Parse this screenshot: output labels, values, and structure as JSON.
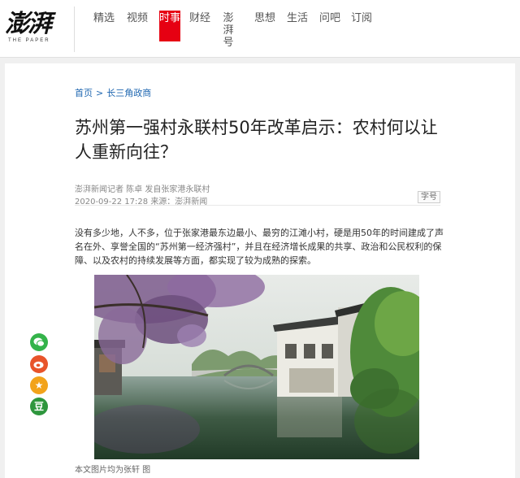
{
  "header": {
    "logo_text": "澎湃",
    "logo_sub": "THE PAPER",
    "nav": [
      {
        "label": "精选"
      },
      {
        "label": "视频"
      },
      {
        "label": "时事"
      },
      {
        "label": "财经"
      },
      {
        "label": "澎湃号"
      },
      {
        "label": "思想"
      },
      {
        "label": "生活"
      },
      {
        "label": "问吧"
      },
      {
        "label": "订阅"
      }
    ],
    "active_color": "#e60012"
  },
  "breadcrumb": {
    "home": "首页",
    "separator": ">",
    "section": "长三角政商"
  },
  "article": {
    "title": "苏州第一强村永联村50年改革启示：农村何以让人重新向往？",
    "byline": "澎湃新闻记者 陈卓 发自张家港永联村",
    "datetime": "2020-09-22 17:28",
    "source": "来源：澎湃新闻",
    "font_button": "字号",
    "paragraph": "没有多少地，人不多，位于张家港最东边最小、最穷的江滩小村，硬是用50年的时间建成了声名在外、享誉全国的“苏州第一经济强村”，并且在经济增长成果的共享、政治和公民权利的保障、以及农村的持续发展等方面，都实现了较为成熟的探索。",
    "caption": "本文图片均为张轩 图"
  },
  "share": [
    {
      "name": "wechat-icon",
      "glyph": "●",
      "color": "#34b34a"
    },
    {
      "name": "weibo-icon",
      "glyph": "◉",
      "color": "#e8542b"
    },
    {
      "name": "favorite-icon",
      "glyph": "★",
      "color": "#f2a31b"
    },
    {
      "name": "douban-icon",
      "glyph": "豆",
      "color": "#2e963d"
    }
  ]
}
